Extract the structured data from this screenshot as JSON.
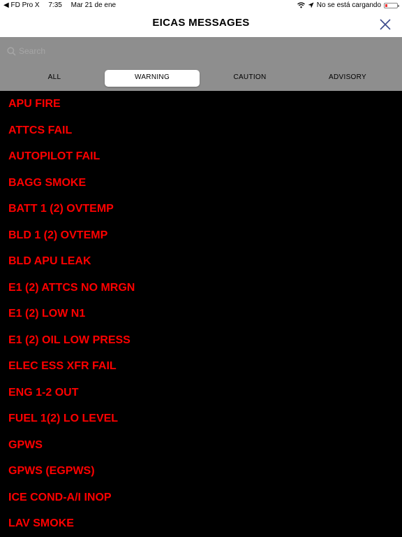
{
  "status_bar": {
    "back_app": "FD Pro X",
    "time": "7:35",
    "date": "Mar 21 de ene",
    "charging": "No se está cargando"
  },
  "header": {
    "title": "EICAS MESSAGES",
    "close_icon": "close-icon"
  },
  "search": {
    "placeholder": "Search",
    "value": ""
  },
  "tabs": [
    {
      "label": "ALL"
    },
    {
      "label": "WARNING"
    },
    {
      "label": "CAUTION"
    },
    {
      "label": "ADVISORY"
    }
  ],
  "selected_tab": "WARNING",
  "colors": {
    "warning": "#ff0000",
    "background": "#000000",
    "search_bg": "#8e8e8e"
  },
  "messages": [
    "APU FIRE",
    "ATTCS FAIL",
    "AUTOPILOT FAIL",
    "BAGG SMOKE",
    "BATT 1 (2) OVTEMP",
    "BLD 1 (2) OVTEMP",
    "BLD APU LEAK",
    "E1 (2) ATTCS NO MRGN",
    "E1 (2) LOW N1",
    "E1 (2) OIL LOW PRESS",
    "ELEC ESS XFR FAIL",
    "ENG 1-2 OUT",
    "FUEL 1(2) LO LEVEL",
    "GPWS",
    "GPWS (EGPWS)",
    "ICE COND-A/I INOP",
    "LAV SMOKE"
  ]
}
